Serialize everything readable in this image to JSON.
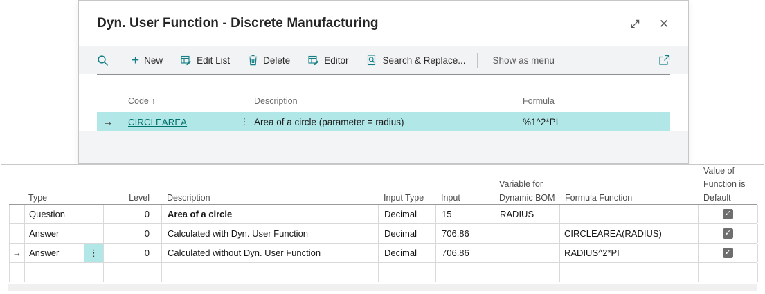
{
  "window": {
    "title": "Dyn. User Function - Discrete Manufacturing"
  },
  "toolbar": {
    "new_label": "New",
    "edit_list_label": "Edit List",
    "delete_label": "Delete",
    "editor_label": "Editor",
    "search_replace_label": "Search & Replace...",
    "show_as_menu_label": "Show as menu"
  },
  "function_list": {
    "columns": {
      "code": "Code",
      "description": "Description",
      "formula": "Formula"
    },
    "row": {
      "code": "CIRCLEAREA",
      "description": "Area of a circle (parameter = radius)",
      "formula": "%1^2*PI"
    }
  },
  "detail_table": {
    "columns": {
      "type": "Type",
      "level": "Level",
      "description": "Description",
      "input_type": "Input Type",
      "input": "Input",
      "variable": "Variable for Dynamic BOM",
      "formula_function": "Formula Function",
      "default": "Value of Function is Default"
    },
    "rows": [
      {
        "type": "Question",
        "level": "0",
        "description": "Area of a circle",
        "input_type": "Decimal",
        "input": "15",
        "variable": "RADIUS",
        "formula_function": "",
        "default_checked": "true"
      },
      {
        "type": "Answer",
        "level": "0",
        "description": "Calculated with Dyn. User Function",
        "input_type": "Decimal",
        "input": "706.86",
        "variable": "",
        "formula_function": "CIRCLEAREA(RADIUS)",
        "default_checked": "true"
      },
      {
        "type": "Answer",
        "level": "0",
        "description": "Calculated without Dyn. User Function",
        "input_type": "Decimal",
        "input": "706.86",
        "variable": "",
        "formula_function": "RADIUS^2*PI",
        "default_checked": "true"
      },
      {
        "type": "",
        "level": "",
        "description": "",
        "input_type": "",
        "input": "",
        "variable": "",
        "formula_function": "",
        "default_checked": "false"
      }
    ]
  },
  "icons": {
    "plus": "+",
    "close": "✕",
    "sort_ascending": "↑",
    "row_marker": "→",
    "ellipsis": "⋮",
    "check": "✓"
  },
  "colors": {
    "accent_teal": "#137e84",
    "link_teal": "#00716c",
    "selection_cyan": "#b2e7e8",
    "toolbar_bg": "#f2f3f5",
    "checkbox_gray": "#6e6e6e"
  }
}
